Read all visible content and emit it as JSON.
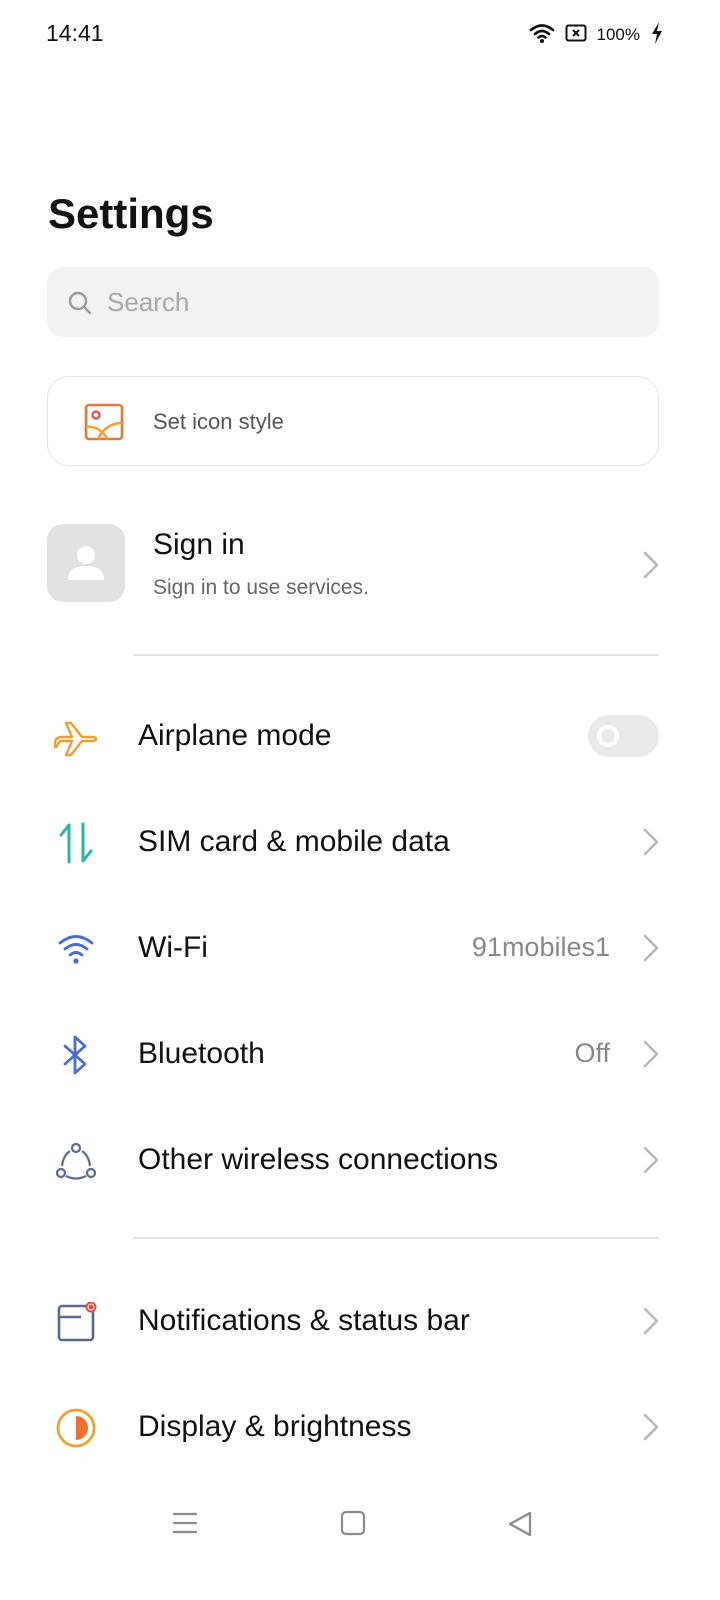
{
  "status_bar": {
    "time": "14:41",
    "battery_percent": "100%",
    "icons": [
      "wifi-icon",
      "sim-error-icon",
      "charging-icon"
    ]
  },
  "page_title": "Settings",
  "search": {
    "placeholder": "Search",
    "value": ""
  },
  "icon_style_card": {
    "label": "Set icon style",
    "icon": "image-style-icon"
  },
  "sign_in": {
    "title": "Sign in",
    "subtitle": "Sign in to use services.",
    "icon": "person-icon"
  },
  "settings": [
    {
      "id": "airplane",
      "label": "Airplane mode",
      "icon": "airplane-icon",
      "icon_color": "#f0a030",
      "control": "toggle",
      "toggle_on": false
    },
    {
      "id": "sim",
      "label": "SIM card & mobile data",
      "icon": "data-arrows-icon",
      "icon_color": "#2bb5a0",
      "control": "chevron"
    },
    {
      "id": "wifi",
      "label": "Wi-Fi",
      "value": "91mobiles1",
      "icon": "wifi-icon",
      "icon_color": "#4a6bd0",
      "control": "chevron"
    },
    {
      "id": "bluetooth",
      "label": "Bluetooth",
      "value": "Off",
      "icon": "bluetooth-icon",
      "icon_color": "#4a6bd0",
      "control": "chevron"
    },
    {
      "id": "wireless",
      "label": "Other wireless connections",
      "icon": "connections-icon",
      "icon_color": "#5a6a8a",
      "control": "chevron"
    },
    {
      "id": "notifications",
      "label": "Notifications & status bar",
      "icon": "notification-icon",
      "icon_color": "#5a6a8a",
      "badge_color": "#e84a4a",
      "control": "chevron"
    },
    {
      "id": "display",
      "label": "Display & brightness",
      "icon": "brightness-icon",
      "icon_color": "#f08030",
      "control": "chevron"
    }
  ],
  "nav_bar": {
    "buttons": [
      "menu-icon",
      "home-icon",
      "back-icon"
    ]
  },
  "colors": {
    "accent_orange": "#f08030",
    "accent_blue": "#4a6bd0",
    "accent_teal": "#2bb5a0",
    "text_primary": "#111111",
    "text_secondary": "#888888"
  }
}
